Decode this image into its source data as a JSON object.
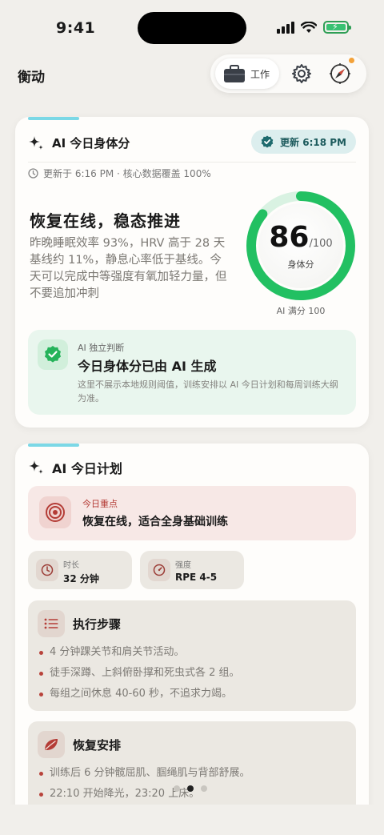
{
  "status_bar": {
    "time": "9:41"
  },
  "header": {
    "app_title": "衡动",
    "toolbar": {
      "work_label": "工作",
      "icons": [
        "briefcase-icon",
        "gear-icon",
        "compass-icon"
      ]
    }
  },
  "body_score_card": {
    "title": "AI 今日身体分",
    "update_pill": "更新 6:18 PM",
    "meta": "更新于 6:16 PM · 核心数据覆盖 100%",
    "headline": "恢复在线，稳态推进",
    "description": "昨晚睡眠效率 93%，HRV 高于 28 天基线约 11%，静息心率低于基线。今天可以完成中等强度有氧加轻力量，但不要追加冲刺",
    "score": {
      "value": "86",
      "denominator": "/100",
      "label": "身体分",
      "fraction": 0.86
    },
    "ring_caption": "AI 满分 100",
    "ai_note": {
      "kicker": "AI 独立判断",
      "headline": "今日身体分已由 AI 生成",
      "description": "这里不展示本地规则阈值，训练安排以 AI 今日计划和每周训练大纲为准。"
    }
  },
  "plan_card": {
    "title": "AI 今日计划",
    "focus": {
      "kicker": "今日重点",
      "value": "恢复在线，适合全身基础训练"
    },
    "duration": {
      "label": "时长",
      "value": "32 分钟"
    },
    "intensity": {
      "label": "强度",
      "value": "RPE 4-5"
    },
    "steps": {
      "title": "执行步骤",
      "items": [
        "4 分钟踝关节和肩关节活动。",
        "徒手深蹲、上斜俯卧撑和死虫式各 2 组。",
        "每组之间休息 40-60 秒，不追求力竭。"
      ]
    },
    "recovery": {
      "title": "恢复安排",
      "items": [
        "训练后 6 分钟髋屈肌、腘绳肌与背部舒展。",
        "22:10 开始降光，23:20 上床。"
      ]
    }
  },
  "pager": {
    "count": 3,
    "active": 1
  },
  "colors": {
    "ring_green": "#22c062",
    "accent_teal": "#7bd8e6",
    "focus_red": "#b43c36"
  }
}
